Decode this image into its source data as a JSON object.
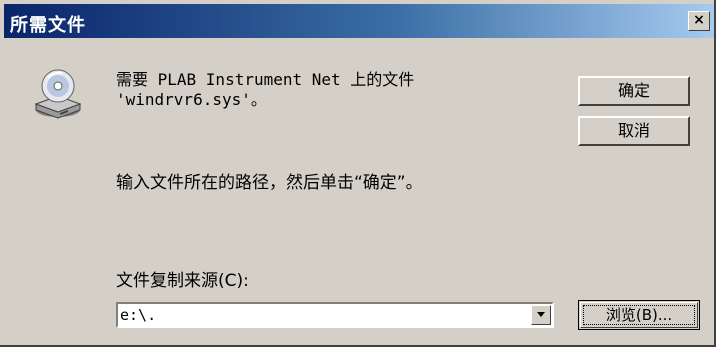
{
  "window": {
    "title": "所需文件",
    "close_glyph": "×"
  },
  "message": {
    "line1": "需要 PLAB Instrument Net 上的文件",
    "line2": "'windrvr6.sys'。",
    "instruction": "输入文件所在的路径，然后单击“确定”。"
  },
  "buttons": {
    "ok_label": "确定",
    "cancel_label": "取消",
    "browse_label": "浏览(B)..."
  },
  "source": {
    "label": "文件复制来源(C):",
    "value": "e:\\."
  },
  "icons": {
    "dialog_icon": "disk-drive-icon",
    "dropdown_icon": "chevron-down-icon"
  },
  "colors": {
    "title_start": "#0a246a",
    "title_end": "#a6caf0",
    "face": "#d4d0c8"
  }
}
